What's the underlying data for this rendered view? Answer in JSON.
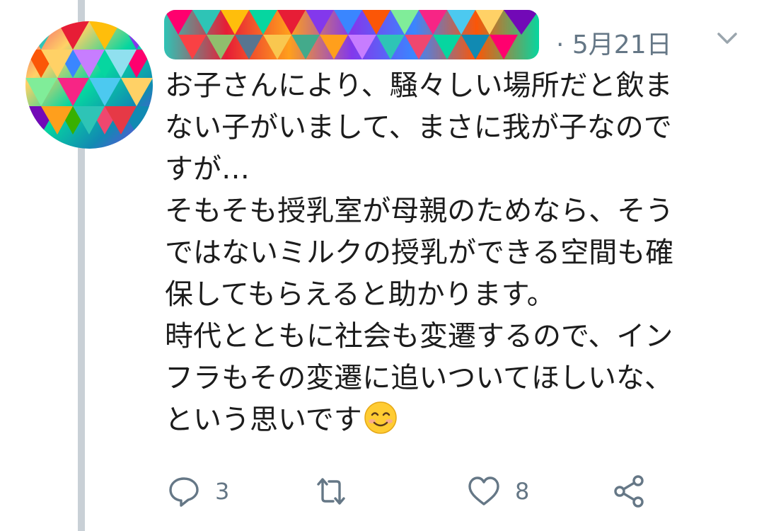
{
  "tweet": {
    "timestamp": "· 5月21日",
    "text_lines": [
      "お子さんにより、騒々しい場所だと飲ま",
      "ない子がいまして、まさに我が子なので",
      "すが…",
      "そもそも授乳室が母親のためなら、そう",
      "ではないミルクの授乳ができる空間も確",
      "保してもらえると助かります。",
      "時代とともに社会も変遷するので、イン",
      "フラもその変遷に追いついてほしいな、",
      "という思いです"
    ],
    "emoji": "smiling-face-icon"
  },
  "actions": {
    "reply_count": "3",
    "retweet_count": "",
    "like_count": "8"
  },
  "colors": {
    "meta": "#657786",
    "thread_line": "#c9d0d6",
    "text": "#1c1c1c"
  }
}
